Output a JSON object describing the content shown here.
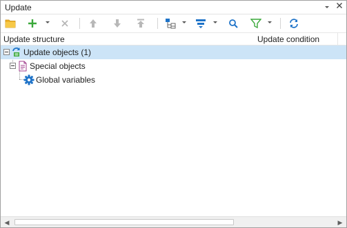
{
  "window": {
    "title": "Update",
    "pin_icon": "pin-icon",
    "close_icon": "close-icon"
  },
  "toolbar": {
    "items": [
      {
        "name": "open-folder-button",
        "icon": "folder-icon"
      },
      {
        "name": "add-button",
        "icon": "plus-icon",
        "dropdown": true
      },
      {
        "name": "delete-button",
        "icon": "x-icon",
        "disabled": true
      },
      {
        "name": "move-up-button",
        "icon": "arrow-up-icon",
        "disabled": true
      },
      {
        "name": "move-down-button",
        "icon": "arrow-down-icon",
        "disabled": true
      },
      {
        "name": "move-top-button",
        "icon": "arrow-top-icon",
        "disabled": true
      },
      {
        "name": "tree-view-button",
        "icon": "tree-icon",
        "dropdown": true
      },
      {
        "name": "sort-button",
        "icon": "sort-icon",
        "dropdown": true
      },
      {
        "name": "search-button",
        "icon": "search-icon"
      },
      {
        "name": "filter-button",
        "icon": "funnel-icon",
        "dropdown": true
      },
      {
        "name": "refresh-button",
        "icon": "refresh-icon"
      }
    ]
  },
  "columns": {
    "structure": "Update structure",
    "condition": "Update condition"
  },
  "tree": [
    {
      "label": "Update objects (1)",
      "icon": "update-objects-icon",
      "level": 0,
      "expanded": true,
      "selected": true
    },
    {
      "label": "Special objects",
      "icon": "document-icon",
      "level": 1,
      "expanded": true,
      "selected": false
    },
    {
      "label": "Global variables",
      "icon": "gear-icon",
      "level": 2,
      "expanded": false,
      "selected": false
    }
  ],
  "colors": {
    "selection": "#cce4f7",
    "accent_blue": "#1e73c8",
    "accent_green": "#3aa83a"
  }
}
